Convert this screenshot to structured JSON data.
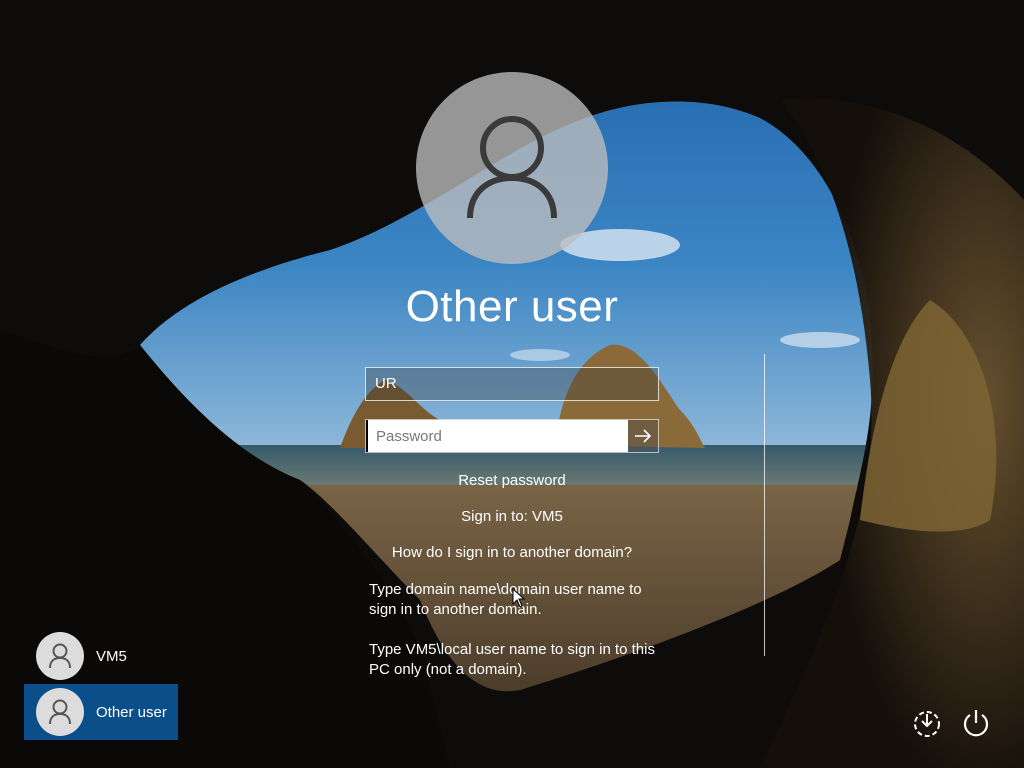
{
  "login": {
    "title": "Other user",
    "username_value": "UR",
    "password_placeholder": "Password",
    "reset_password": "Reset password",
    "sign_in_to": "Sign in to: VM5",
    "other_domain_link": "How do I sign in to another domain?",
    "help_line_1": "Type domain name\\domain user name to sign in to another domain.",
    "help_line_2": "Type VM5\\local user name to sign in to this PC only (not a domain)."
  },
  "users": [
    {
      "label": "VM5",
      "selected": false
    },
    {
      "label": "Other user",
      "selected": true
    }
  ],
  "icons": {
    "avatar": "user-icon",
    "submit": "arrow-right-icon",
    "accessibility": "ease-of-access-icon",
    "power": "power-icon"
  },
  "colors": {
    "selected_tile": "#0b4f8a",
    "avatar_bg": "#bebebe"
  }
}
